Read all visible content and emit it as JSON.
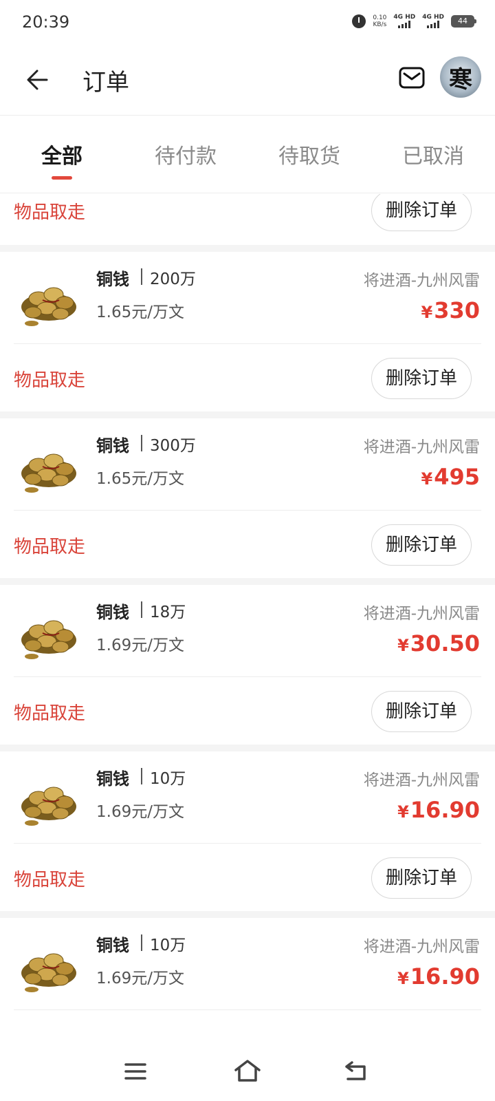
{
  "status_bar": {
    "time": "20:39",
    "speed_value": "0.10",
    "speed_unit": "KB/s",
    "sim1_label": "4G HD",
    "sim2_label": "4G HD",
    "battery": "44"
  },
  "header": {
    "title": "订单",
    "back_icon": "arrow-left-icon",
    "mail_icon": "mail-icon",
    "avatar_char": "寒"
  },
  "tabs": [
    {
      "label": "全部",
      "active": true
    },
    {
      "label": "待付款",
      "active": false
    },
    {
      "label": "待取货",
      "active": false
    },
    {
      "label": "已取消",
      "active": false
    }
  ],
  "partial_order": {
    "status": "物品取走",
    "delete_label": "删除订单"
  },
  "orders": [
    {
      "name": "铜钱",
      "qty": "200万",
      "unit_price": "1.65元/万文",
      "server": "将进酒-九州风雷",
      "currency": "¥",
      "price": "330",
      "status": "物品取走",
      "delete_label": "删除订单"
    },
    {
      "name": "铜钱",
      "qty": "300万",
      "unit_price": "1.65元/万文",
      "server": "将进酒-九州风雷",
      "currency": "¥",
      "price": "495",
      "status": "物品取走",
      "delete_label": "删除订单"
    },
    {
      "name": "铜钱",
      "qty": "18万",
      "unit_price": "1.69元/万文",
      "server": "将进酒-九州风雷",
      "currency": "¥",
      "price": "30.50",
      "status": "物品取走",
      "delete_label": "删除订单"
    },
    {
      "name": "铜钱",
      "qty": "10万",
      "unit_price": "1.69元/万文",
      "server": "将进酒-九州风雷",
      "currency": "¥",
      "price": "16.90",
      "status": "物品取走",
      "delete_label": "删除订单"
    },
    {
      "name": "铜钱",
      "qty": "10万",
      "unit_price": "1.69元/万文",
      "server": "将进酒-九州风雷",
      "currency": "¥",
      "price": "16.90",
      "status": "",
      "delete_label": ""
    }
  ],
  "colors": {
    "accent_red": "#e23b30",
    "status_red": "#d9443a",
    "tab_underline": "#e2483c"
  },
  "navbar": {
    "menu_icon": "menu-icon",
    "home_icon": "home-icon",
    "back_icon": "back-icon"
  }
}
